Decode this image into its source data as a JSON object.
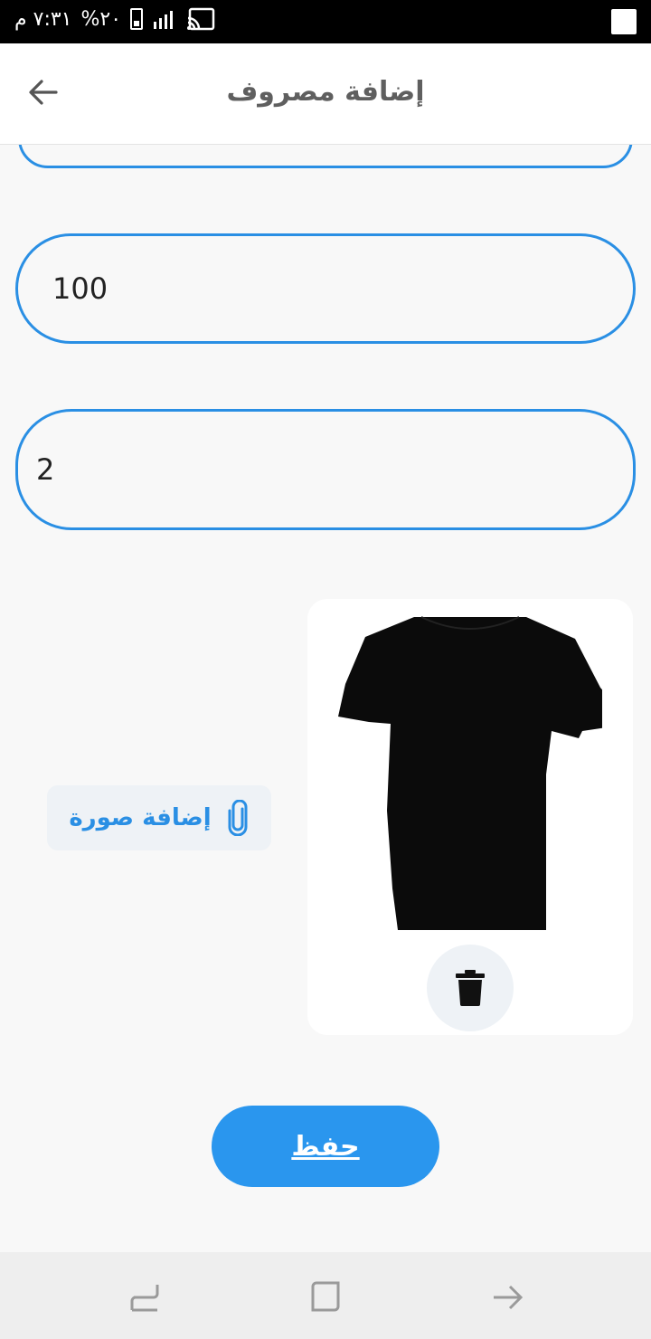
{
  "status_bar": {
    "time": "٧:٣١ م",
    "battery": "%٢٠"
  },
  "app_bar": {
    "title": "إضافة مصروف",
    "back_icon": "arrow-left-icon"
  },
  "form": {
    "amount_value": "100",
    "quantity_value": "2"
  },
  "attachment": {
    "add_image_label": "إضافة صورة",
    "attach_icon": "paperclip-icon",
    "delete_icon": "trash-icon"
  },
  "actions": {
    "save_label": "حفظ"
  },
  "colors": {
    "accent": "#2a8fe4",
    "save_button": "#2a96ee",
    "background": "#f8f8f8"
  },
  "nav_bar": {
    "icons": [
      "recent-apps-icon",
      "home-icon",
      "back-nav-icon"
    ]
  }
}
